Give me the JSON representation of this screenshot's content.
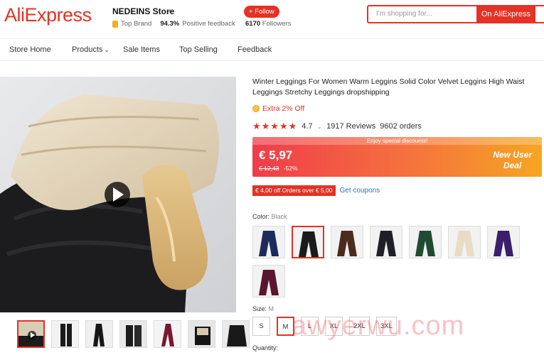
{
  "header": {
    "logo": "AliExpress",
    "store_name": "NEDEINS Store",
    "store_caret": "▾",
    "top_brand": "Top Brand",
    "feedback_pct": "94.3%",
    "feedback_text": "Positive feedback",
    "follow_label": "+ Follow",
    "followers_count": "6170",
    "followers_text": "Followers",
    "search_placeholder": "I'm shopping for...",
    "search_button": "On AliExpress"
  },
  "nav": {
    "items": [
      "Store Home",
      "Products",
      "Sale Items",
      "Top Selling",
      "Feedback"
    ]
  },
  "product": {
    "title": "Winter Leggings For Women Warm Leggins Solid Color Velvet Leggins High Waist Leggings Stretchy Leggings dropshipping",
    "extra_off": "Extra 2% Off",
    "stars": "★★★★★",
    "rating": "4.7",
    "rating_caret": "⌄",
    "reviews": "1917 Reviews",
    "orders": "9602 orders",
    "price_banner": "Enjoy special discounts!",
    "price": "€ 5,97",
    "old_price": "€ 12,43",
    "discount": "-52%",
    "new_user_line1": "New User",
    "new_user_line2": "Deal",
    "coupon_tag": "€ 4,00 off Orders over € 5,00",
    "coupon_link": "Get coupons",
    "color_label": "Color:",
    "color_value": "Black",
    "size_label": "Size:",
    "size_value": "M",
    "sizes": [
      "S",
      "M",
      "L",
      "XL",
      "2XL",
      "3XL"
    ],
    "quantity_label": "Quantity:"
  },
  "watermark": "awyerwu.com",
  "colors": {
    "brand_red": "#e43225",
    "swatches": [
      "#1d2a5a",
      "#1b1b1b",
      "#4a2c1e",
      "#1f1f26",
      "#1f4b32",
      "#e8dcc4",
      "#3b1f6b",
      "#5a1530"
    ]
  }
}
